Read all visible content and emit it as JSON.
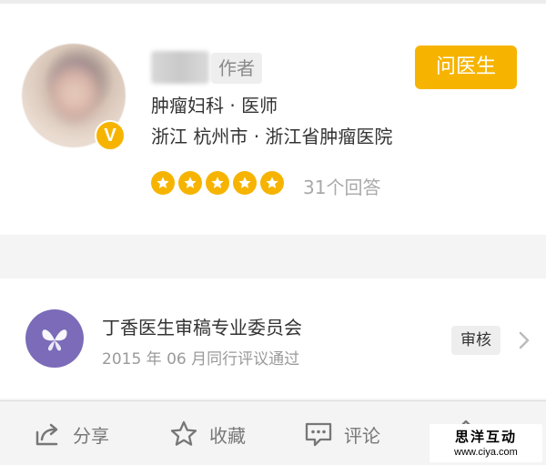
{
  "author": {
    "tag": "作者",
    "department_title": "肿瘤妇科 · 医师",
    "location_hospital": "浙江 杭州市 · 浙江省肿瘤医院",
    "verified_badge": "V",
    "rating_stars": 5,
    "answer_count": "31个回答",
    "ask_button": "问医生"
  },
  "review": {
    "committee_name": "丁香医生审稿专业委员会",
    "date_text": "2015 年 06 月同行评议通过",
    "tag": "审核"
  },
  "toolbar": {
    "share": "分享",
    "favorite": "收藏",
    "comment": "评论"
  },
  "watermark": {
    "title": "思洋互动",
    "url": "www.ciya.com"
  },
  "colors": {
    "accent": "#f6b400",
    "committee_logo": "#7b6bb8"
  }
}
